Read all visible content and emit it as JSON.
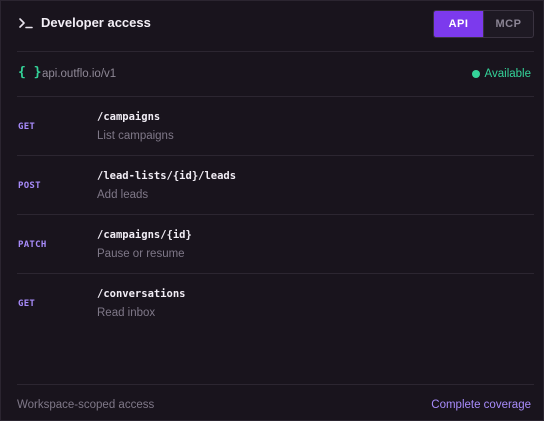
{
  "header": {
    "title": "Developer access",
    "toggle": {
      "api_label": "API",
      "mcp_label": "MCP",
      "selected": "API"
    }
  },
  "base": {
    "url": "api.outflo.io/v1",
    "status": "Available",
    "status_color": "#34d399"
  },
  "endpoints": [
    {
      "method": "GET",
      "path": "/campaigns",
      "description": "List campaigns"
    },
    {
      "method": "POST",
      "path": "/lead-lists/{id}/leads",
      "description": "Add leads"
    },
    {
      "method": "PATCH",
      "path": "/campaigns/{id}",
      "description": "Pause or resume"
    },
    {
      "method": "GET",
      "path": "/conversations",
      "description": "Read inbox"
    }
  ],
  "footer": {
    "left": "Workspace-scoped access",
    "right": "Complete coverage"
  },
  "colors": {
    "background": "#19141d",
    "accent": "#7c3aed",
    "method": "#a78bfa",
    "available": "#34d399"
  },
  "icons": [
    "terminal-icon",
    "braces-icon",
    "status-dot-icon"
  ]
}
